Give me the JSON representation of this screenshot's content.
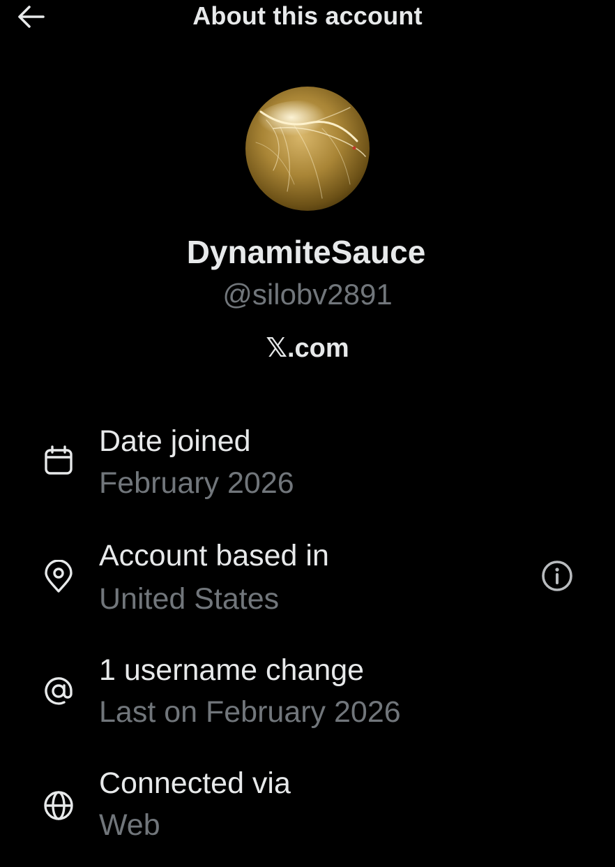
{
  "header": {
    "title": "About this account",
    "back_icon": "arrow-left-icon"
  },
  "profile": {
    "display_name": "DynamiteSauce",
    "handle": "@silobv2891",
    "source": "𝕏.com"
  },
  "rows": [
    {
      "icon": "calendar-icon",
      "label": "Date joined",
      "value": "February 2026"
    },
    {
      "icon": "location-pin-icon",
      "label": "Account based in",
      "value": "United States",
      "action_icon": "info-icon"
    },
    {
      "icon": "at-sign-icon",
      "label": "1 username change",
      "value": "Last on February 2026"
    },
    {
      "icon": "globe-icon",
      "label": "Connected via",
      "value": "Web"
    }
  ],
  "colors": {
    "background": "#000000",
    "primary_text": "#e7e9ea",
    "secondary_text": "#71767b"
  }
}
